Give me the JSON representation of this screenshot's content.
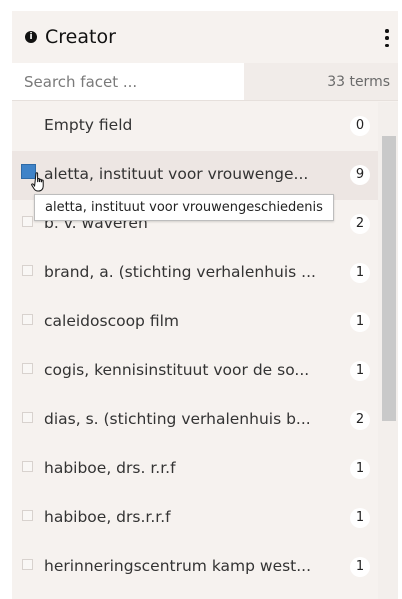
{
  "facet": {
    "title": "Creator",
    "search_placeholder": "Search facet ...",
    "term_count": "33 terms",
    "tooltip": "aletta, instituut voor vrouwengeschiedenis",
    "items": [
      {
        "label": "Empty field",
        "count": "0",
        "checkbox": false
      },
      {
        "label": "aletta, instituut voor vrouwenge...",
        "count": "9",
        "checkbox": true
      },
      {
        "label": "b. v. waveren",
        "count": "2",
        "checkbox": true
      },
      {
        "label": "brand, a. (stichting verhalenhuis ...",
        "count": "1",
        "checkbox": true
      },
      {
        "label": "caleidoscoop film",
        "count": "1",
        "checkbox": true
      },
      {
        "label": "cogis, kennisinstituut voor de so...",
        "count": "1",
        "checkbox": true
      },
      {
        "label": "dias, s. (stichting verhalenhuis b...",
        "count": "2",
        "checkbox": true
      },
      {
        "label": "habiboe, drs. r.r.f",
        "count": "1",
        "checkbox": true
      },
      {
        "label": "habiboe, drs.r.r.f",
        "count": "1",
        "checkbox": true
      },
      {
        "label": "herinneringscentrum kamp west...",
        "count": "1",
        "checkbox": true
      }
    ]
  },
  "icons": {
    "info": "info-icon",
    "menu": "kebab-menu-icon",
    "cursor": "hand-pointer-icon"
  },
  "colors": {
    "panel_bg": "#f6f2ef",
    "checkbox_hover": "#3f83c8"
  }
}
